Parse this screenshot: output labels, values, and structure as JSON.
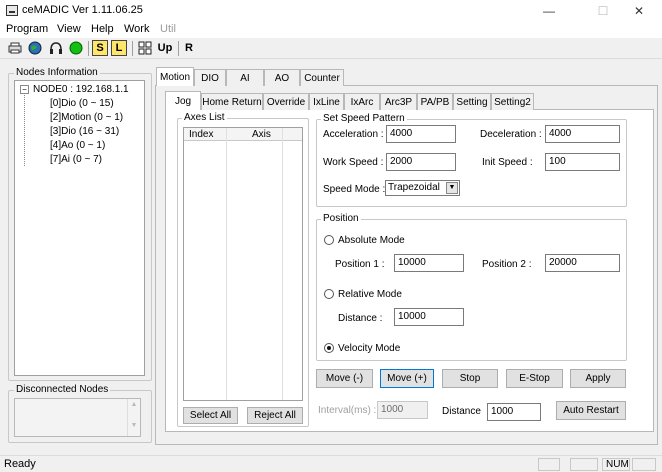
{
  "window": {
    "title": "ceMADIC Ver 1.11.06.25",
    "minimize_glyph": "—",
    "maximize_glyph": "☐",
    "close_glyph": "✕"
  },
  "menu": [
    "Program",
    "View",
    "Help",
    "Work",
    "Util"
  ],
  "toolbar": {
    "icons": [
      "printer-icon",
      "globe-icon",
      "headphones-icon",
      "green-circle-icon",
      "s-icon",
      "l-icon",
      "grid-icon",
      "up-icon",
      "r-icon"
    ],
    "s_label": "S",
    "l_label": "L",
    "up_label": "Up",
    "r_label": "R"
  },
  "nodes_info": {
    "title": "Nodes Information",
    "root": "NODE0 : 192.168.1.1",
    "children": [
      "[0]Dio (0 ~ 15)",
      "[2]Motion (0 ~ 1)",
      "[3]Dio (16 ~ 31)",
      "[4]Ao (0 ~ 1)",
      "[7]Ai (0 ~ 7)"
    ]
  },
  "disconnected_nodes": {
    "title": "Disconnected Nodes"
  },
  "main_tabs": [
    "Motion",
    "DIO",
    "AI",
    "AO",
    "Counter"
  ],
  "sub_tabs": [
    "Jog",
    "Home Return",
    "Override",
    "IxLine",
    "IxArc",
    "Arc3P",
    "PA/PB",
    "Setting",
    "Setting2"
  ],
  "axes_list": {
    "title": "Axes List",
    "columns": [
      "Index",
      "Axis"
    ],
    "select_all": "Select All",
    "reject_all": "Reject All"
  },
  "speed_pattern": {
    "title": "Set Speed Pattern",
    "acceleration_label": "Acceleration :",
    "acceleration": "4000",
    "deceleration_label": "Deceleration :",
    "deceleration": "4000",
    "work_speed_label": "Work Speed :",
    "work_speed": "2000",
    "init_speed_label": "Init Speed :",
    "init_speed": "100",
    "speed_mode_label": "Speed Mode :",
    "speed_mode": "Trapezoidal"
  },
  "position": {
    "title": "Position",
    "absolute_label": "Absolute Mode",
    "position1_label": "Position 1 :",
    "position1": "10000",
    "position2_label": "Position 2 :",
    "position2": "20000",
    "relative_label": "Relative Mode",
    "distance_label": "Distance :",
    "distance": "10000",
    "velocity_label": "Velocity Mode",
    "selected_mode": "Velocity Mode"
  },
  "actions": {
    "move_minus": "Move (-)",
    "move_plus": "Move (+)",
    "stop": "Stop",
    "estop": "E-Stop",
    "apply": "Apply",
    "interval_label": "Interval(ms) :",
    "interval": "1000",
    "distance_label": "Distance",
    "distance": "1000",
    "auto_restart": "Auto Restart"
  },
  "status": {
    "text": "Ready",
    "num": "NUM"
  }
}
